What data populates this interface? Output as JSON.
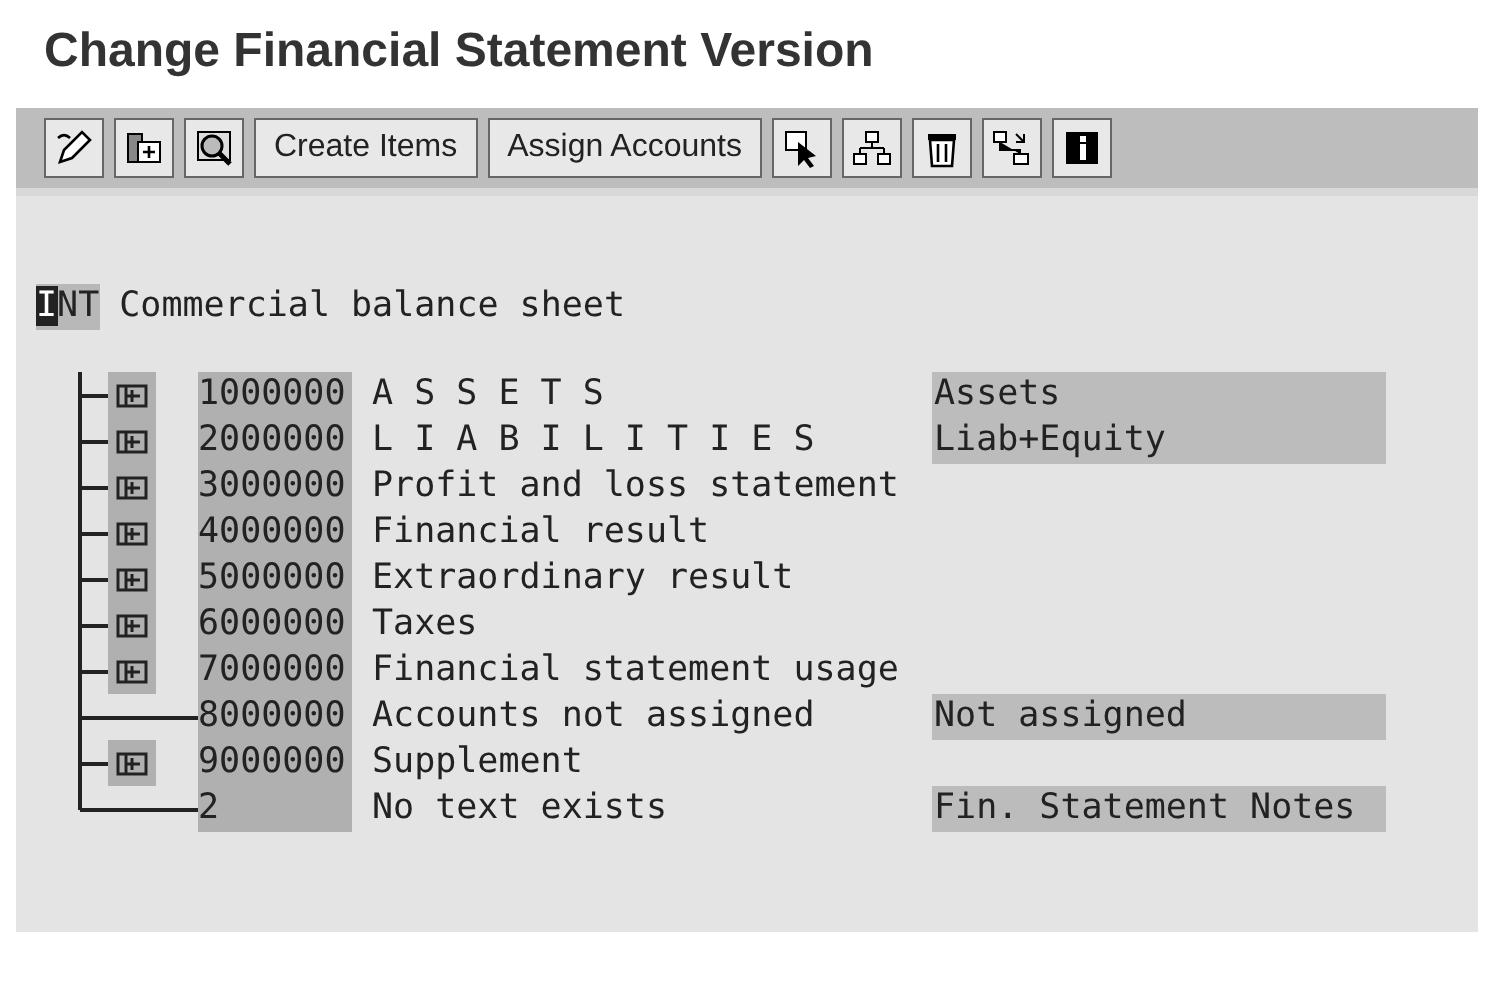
{
  "window": {
    "title": "Change Financial Statement Version"
  },
  "toolbar": {
    "buttons": [
      {
        "kind": "icon"
      },
      {
        "kind": "icon"
      },
      {
        "kind": "icon"
      },
      {
        "kind": "text",
        "label": "Create Items"
      },
      {
        "kind": "text",
        "label": "Assign Accounts"
      },
      {
        "kind": "icon"
      },
      {
        "kind": "icon"
      },
      {
        "kind": "icon"
      },
      {
        "kind": "icon"
      },
      {
        "kind": "icon"
      }
    ]
  },
  "tree": {
    "root": {
      "key": "INT",
      "text": "Commercial balance sheet"
    },
    "children": [
      {
        "code": "1000000",
        "text": "A S S E T S",
        "expandable": true,
        "note": "Assets"
      },
      {
        "code": "2000000",
        "text": "L I A B I L I T I E S",
        "expandable": true,
        "note": "Liab+Equity"
      },
      {
        "code": "3000000",
        "text": "Profit and loss statement",
        "expandable": true
      },
      {
        "code": "4000000",
        "text": "Financial result",
        "expandable": true
      },
      {
        "code": "5000000",
        "text": "Extraordinary result",
        "expandable": true
      },
      {
        "code": "6000000",
        "text": "Taxes",
        "expandable": true
      },
      {
        "code": "7000000",
        "text": "Financial statement usage",
        "expandable": true
      },
      {
        "code": "8000000",
        "text": "Accounts not assigned",
        "expandable": false,
        "note": "Not assigned"
      },
      {
        "code": "9000000",
        "text": "Supplement",
        "expandable": true
      },
      {
        "code": "2",
        "text": "No text exists",
        "expandable": false,
        "note": "Fin. Statement Notes"
      }
    ]
  }
}
